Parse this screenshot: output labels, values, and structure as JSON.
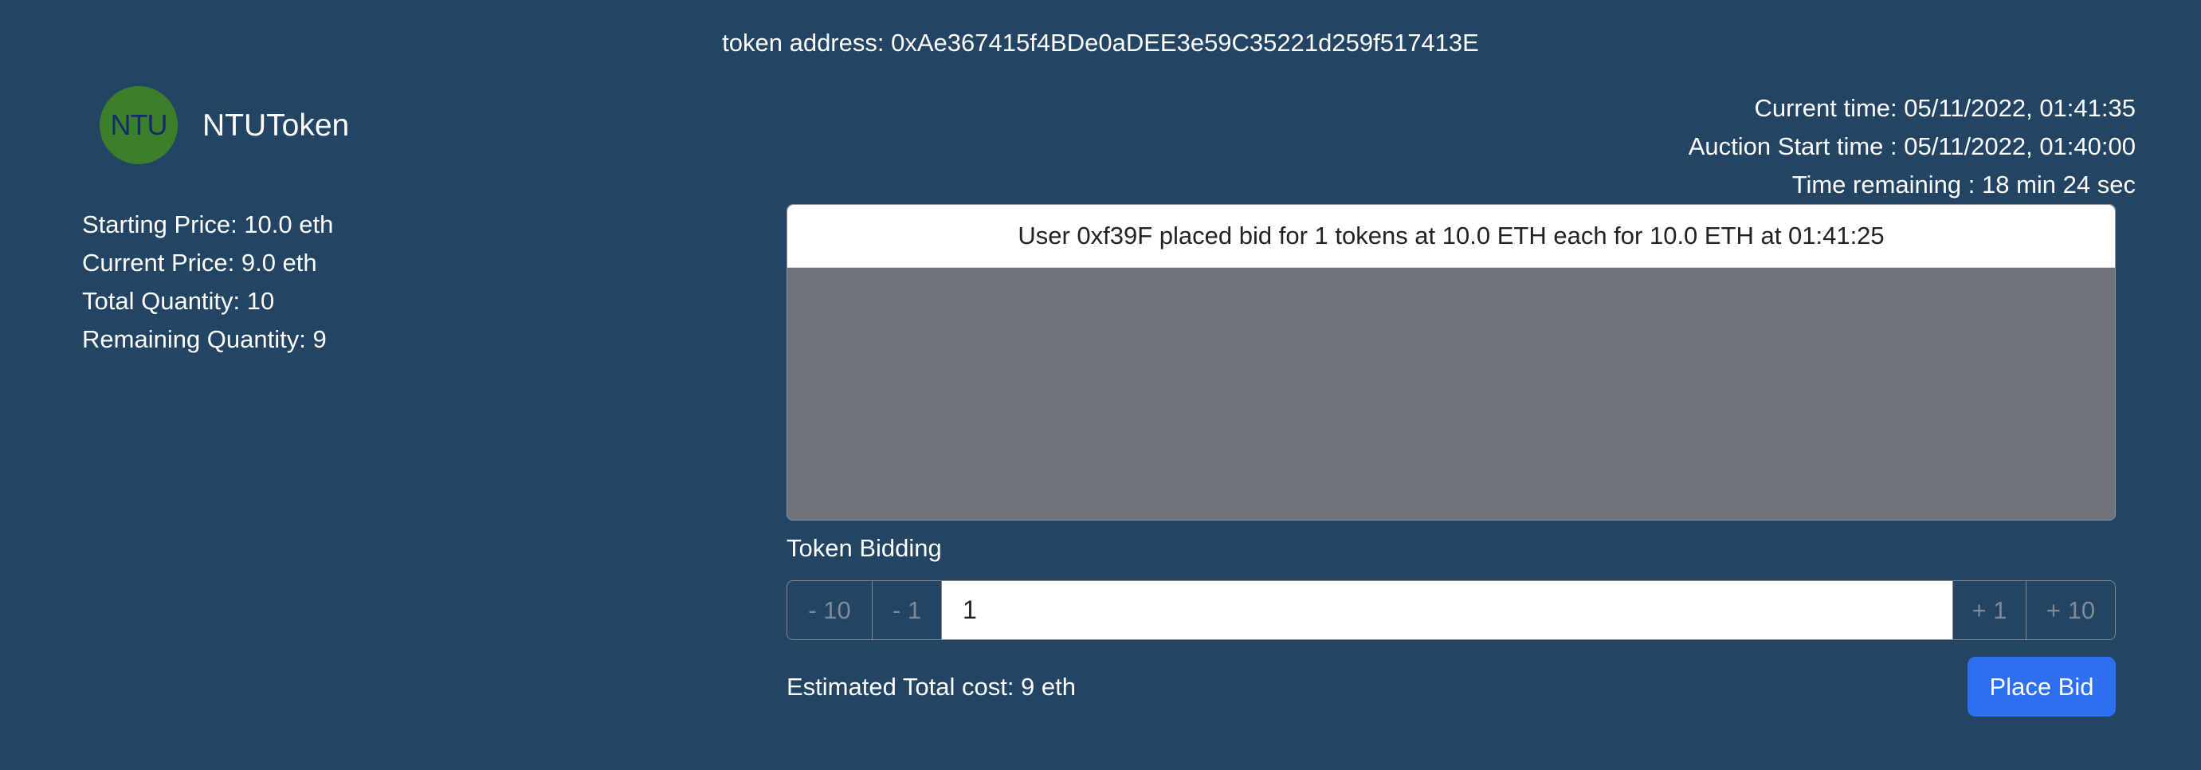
{
  "header": {
    "token_address": "token address: 0xAe367415f4BDe0aDEE3e59C35221d259f517413E"
  },
  "brand": {
    "logo_text": "NTU",
    "logo_color": "#3b7f2b",
    "token_name": "NTUToken"
  },
  "stats": {
    "starting_price": "Starting Price: 10.0 eth",
    "current_price": "Current Price: 9.0 eth",
    "total_quantity": "Total Quantity: 10",
    "remaining_quantity": "Remaining Quantity: 9"
  },
  "times": {
    "current_time": "Current time: 05/11/2022, 01:41:35",
    "auction_start": "Auction Start time : 05/11/2022, 01:40:00",
    "time_remaining": "Time remaining : 18 min 24 sec"
  },
  "bid_log": {
    "items": [
      "User 0xf39F placed bid for 1 tokens at 10.0 ETH each for 10.0 ETH at 01:41:25"
    ]
  },
  "bidding": {
    "label": "Token Bidding",
    "minus_10": "- 10",
    "minus_1": "- 1",
    "quantity_value": "1",
    "plus_1": "+ 1",
    "plus_10": "+ 10"
  },
  "footer": {
    "estimate": "Estimated Total cost: 9 eth",
    "place_bid_label": "Place Bid",
    "accent_color": "#2e6ef0"
  }
}
